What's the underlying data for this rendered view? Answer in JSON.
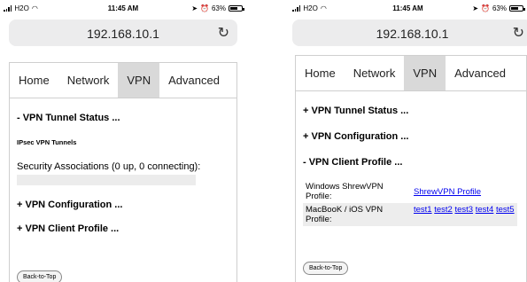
{
  "status_bar": {
    "carrier": "H2O",
    "time": "11:45 AM",
    "battery": "63%"
  },
  "browser": {
    "url": "192.168.10.1"
  },
  "nav": {
    "tabs": [
      "Home",
      "Network",
      "VPN",
      "Advanced"
    ],
    "active": "VPN"
  },
  "left_page": {
    "tunnel_status_heading": "- VPN Tunnel Status ...",
    "ipsec_label": "IPsec VPN Tunnels",
    "security_associations": "Security Associations (0 up, 0 connecting):",
    "vpn_configuration_heading": "+ VPN Configuration ...",
    "client_profile_heading": "+ VPN Client Profile ...",
    "back_to_top": "Back-to-Top"
  },
  "right_page": {
    "tunnel_status_heading": "+ VPN Tunnel Status ...",
    "vpn_configuration_heading": "+ VPN Configuration ...",
    "client_profile_heading": "- VPN Client Profile ...",
    "profiles": [
      {
        "label": "Windows ShrewVPN Profile:",
        "links": [
          "ShrewVPN Profile"
        ]
      },
      {
        "label": "MacBooK / iOS VPN Profile:",
        "links": [
          "test1",
          "test2",
          "test3",
          "test4",
          "test5"
        ]
      }
    ],
    "back_to_top": "Back-to-Top"
  }
}
